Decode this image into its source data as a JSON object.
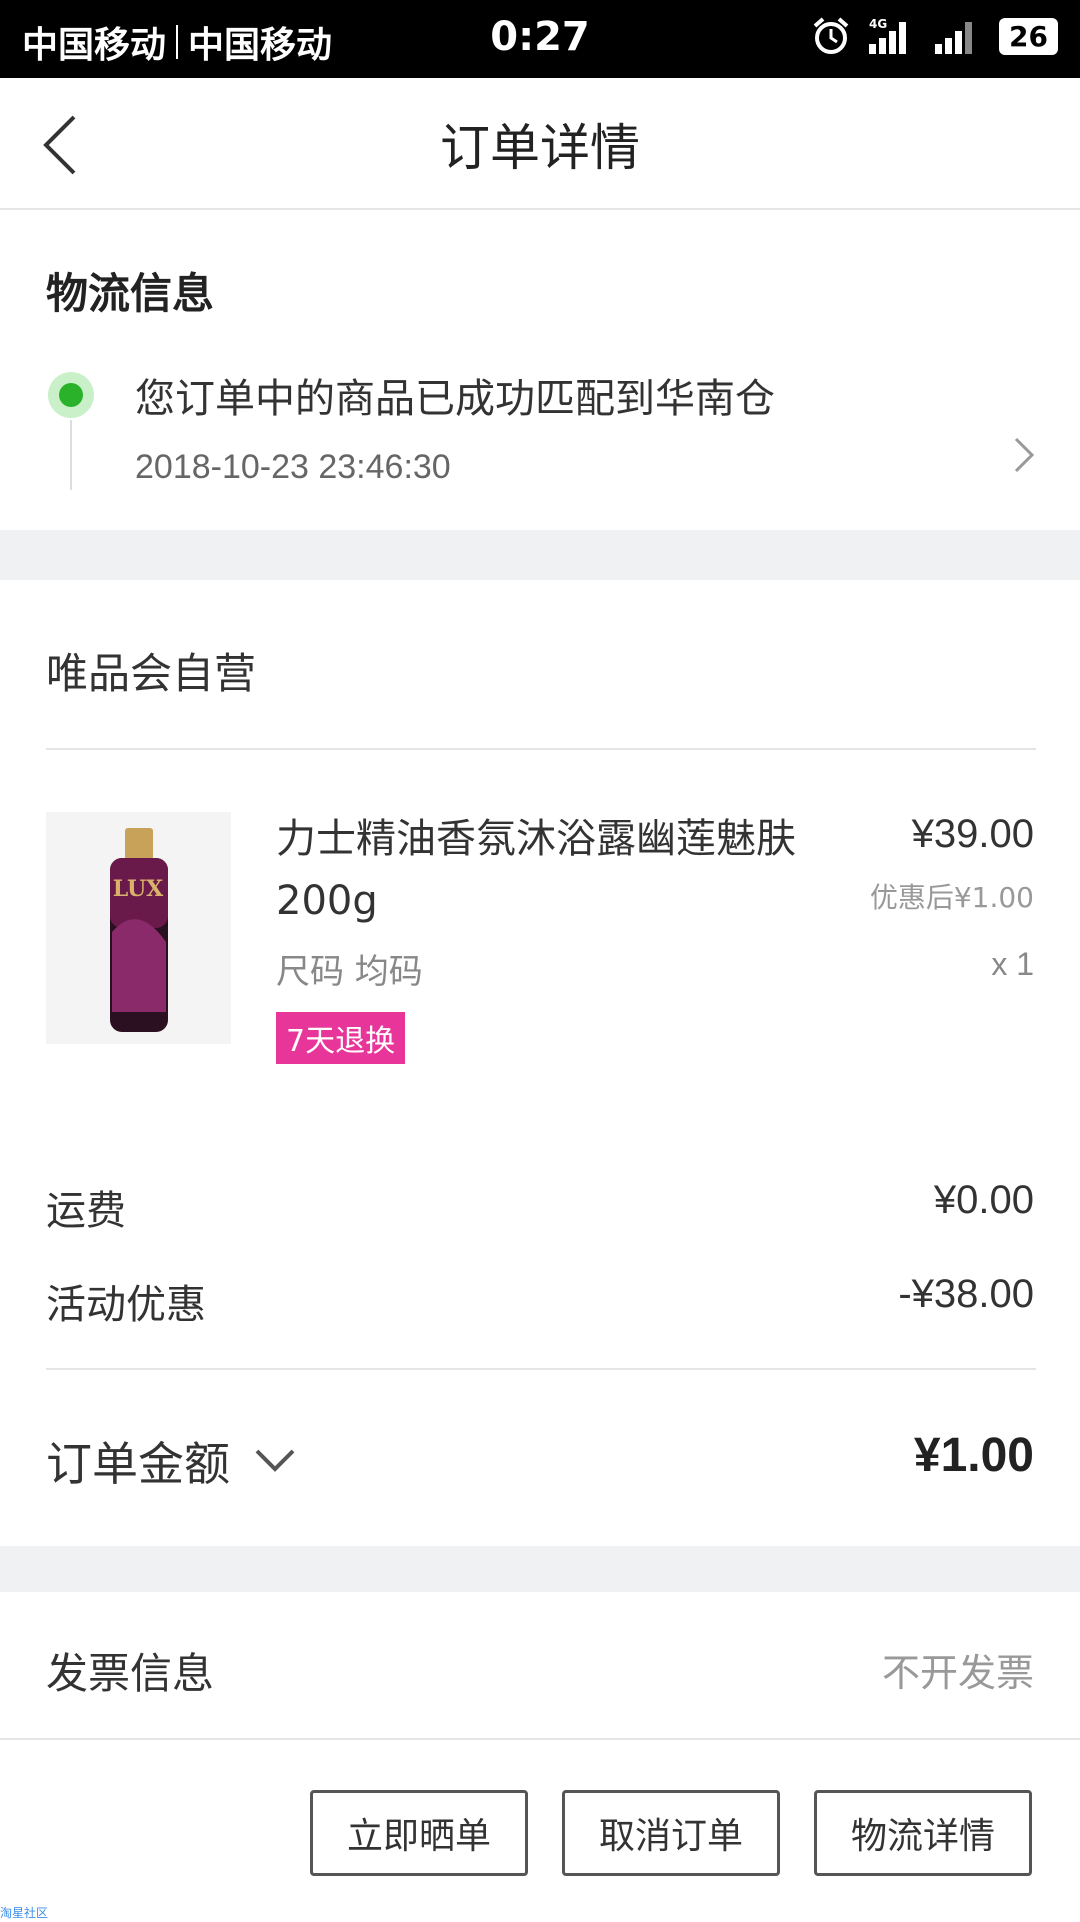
{
  "status_bar": {
    "carrier1": "中国移动",
    "carrier2": "中国移动",
    "time": "0:27",
    "network": "4G",
    "battery": "26"
  },
  "header": {
    "title": "订单详情"
  },
  "logistics": {
    "section_title": "物流信息",
    "message": "您订单中的商品已成功匹配到华南仓",
    "timestamp": "2018-10-23 23:46:30"
  },
  "store": {
    "name": "唯品会自营"
  },
  "product": {
    "name": "力士精油香氛沐浴露幽莲魅肤200g",
    "spec": "尺码 均码",
    "tag": "7天退换",
    "price": "¥39.00",
    "price_after": "优惠后¥1.00",
    "quantity": "x 1",
    "image_brand": "LUX"
  },
  "fees": [
    {
      "label": "运费",
      "value": "¥0.00"
    },
    {
      "label": "活动优惠",
      "value": "-¥38.00"
    }
  ],
  "total": {
    "label": "订单金额",
    "value": "¥1.00"
  },
  "invoice": {
    "label": "发票信息",
    "value": "不开发票"
  },
  "actions": {
    "share": "立即晒单",
    "cancel": "取消订单",
    "logistics": "物流详情"
  },
  "watermark": "淘星社区",
  "colors": {
    "accent_green": "#2ab32a",
    "tag_pink": "#e8359a",
    "bg_gray": "#f0f1f3"
  }
}
